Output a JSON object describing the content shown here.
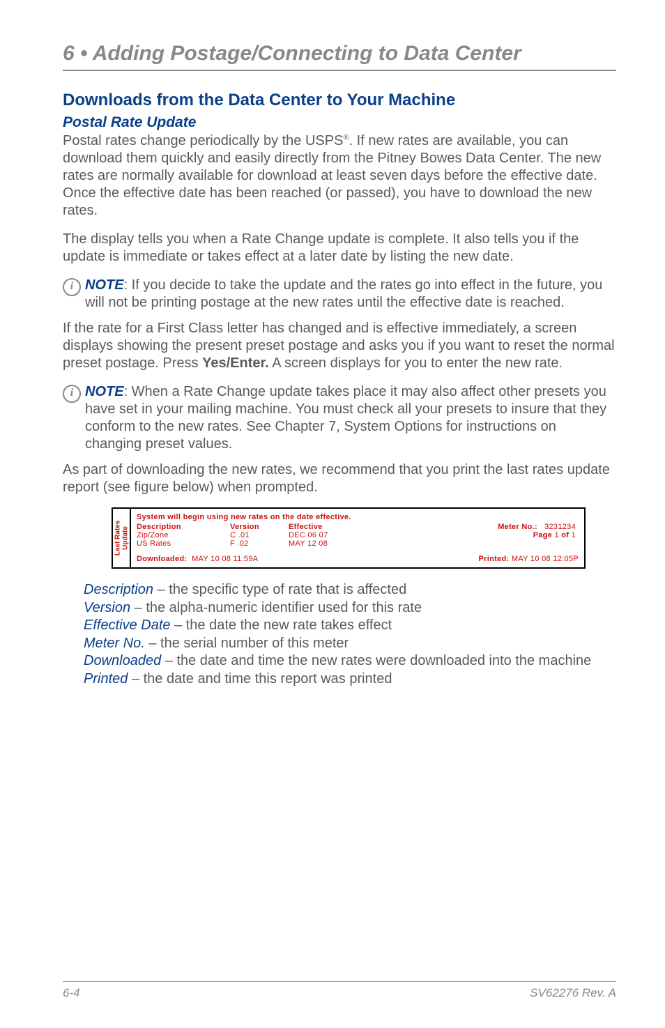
{
  "chapter": {
    "number": "6",
    "title": "Adding Postage/Connecting to Data Center"
  },
  "section_heading": "Downloads from the Data Center to Your Machine",
  "subsection_heading": "Postal Rate Update",
  "para1_a": "Postal rates change periodically by the USPS",
  "para1_b": ". If new rates are available, you can download them quickly and easily directly from the Pitney Bowes Data Center. The new rates are normally available for download at least seven days before the effective date. Once the effective date has been reached (or passed), you have to download the new rates.",
  "para2": "The display tells you when a Rate Change update is complete. It also tells you if the update is immediate or takes effect at a later date by listing the new date.",
  "note1_label": "NOTE",
  "note1_text": ": If you decide to take the update and the rates go into effect in the future, you will not be printing postage at the new rates until the effective date is reached.",
  "para3_a": "If the rate for a First Class letter has changed and is effective immediately, a screen displays showing the present preset postage and asks you if you want to reset the normal preset postage. Press ",
  "para3_bold": "Yes/Enter.",
  "para3_b": " A screen displays for you to enter the new rate.",
  "note2_label": "NOTE",
  "note2_text_a": ": When a Rate Change update takes place it may also affect other presets you have set in your mailing machine. You must check all your presets to insure that they conform to the new rates. See ",
  "note2_ital": "Chapter 7, System Options",
  "note2_text_b": " for instructions on changing preset values.",
  "para4": "As part of downloading the new rates, we recommend that you print the last rates update report (see figure below) when prompted.",
  "report": {
    "sidebar_line1": "Last Rates",
    "sidebar_line2": "Update",
    "title": "System will begin using new rates on the date effective.",
    "headers": {
      "desc": "Description",
      "ver": "Version",
      "eff": "Effective"
    },
    "rows": [
      {
        "desc": "Zip/Zone",
        "ver": "C .01",
        "eff": "DEC  06  07"
      },
      {
        "desc": "US Rates",
        "ver": "F .02",
        "eff": "MAY  12  08"
      }
    ],
    "meter_label": "Meter No.:",
    "meter_no": "3231234",
    "page_label": "Page",
    "page_val_a": "1",
    "page_of": "of",
    "page_val_b": "1",
    "downloaded_label": "Downloaded:",
    "downloaded_val": "MAY  10  08  11:59A",
    "printed_label": "Printed:",
    "printed_val": "MAY  10  08  12:05P"
  },
  "legend": {
    "description": {
      "term": "Description",
      "text": " – the specific type of rate that is affected"
    },
    "version": {
      "term": "Version",
      "text": " – the alpha-numeric identifier used for this rate"
    },
    "effective": {
      "term": "Effective Date",
      "text": " – the date the new rate takes effect"
    },
    "meter": {
      "term": "Meter No.",
      "text": " – the serial number of this meter"
    },
    "downloaded": {
      "term": "Downloaded",
      "text": " – the date and time the new rates were downloaded into the machine"
    },
    "printed": {
      "term": "Printed",
      "text": " – the date and time this report was printed"
    }
  },
  "footer": {
    "page": "6-4",
    "doc": "SV62276 Rev. A"
  }
}
